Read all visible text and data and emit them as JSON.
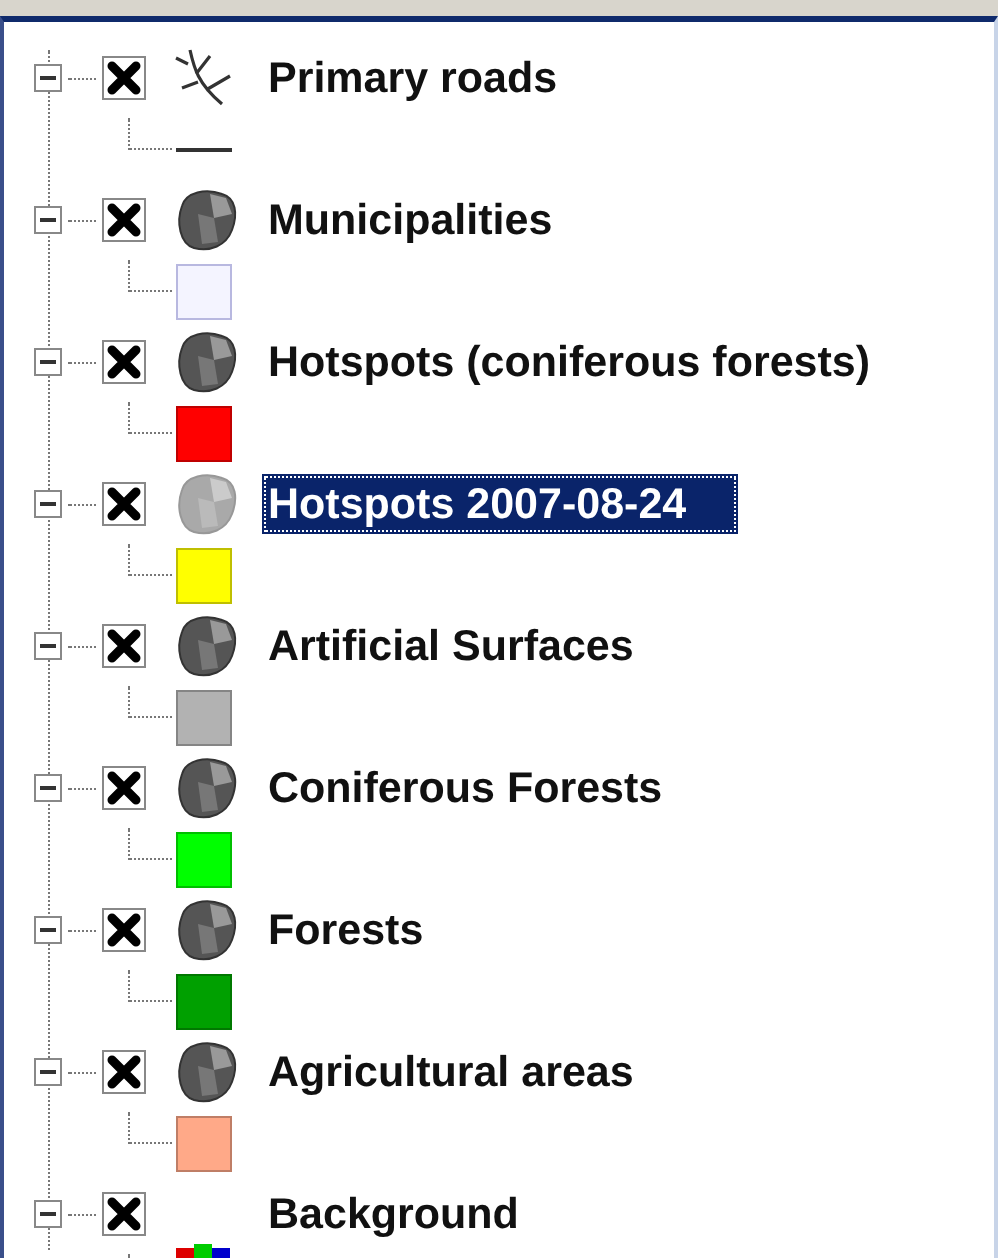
{
  "layers": [
    {
      "name": "Primary roads",
      "checked": true,
      "selected": false,
      "kind": "line",
      "legend": {
        "kind": "line"
      }
    },
    {
      "name": "Municipalities",
      "checked": true,
      "selected": false,
      "kind": "polygon",
      "legend": {
        "kind": "swatch",
        "color": "#f4f4ff"
      }
    },
    {
      "name": "Hotspots (coniferous forests)",
      "checked": true,
      "selected": false,
      "kind": "polygon",
      "legend": {
        "kind": "swatch",
        "color": "#ff0000"
      }
    },
    {
      "name": "Hotspots 2007-08-24",
      "checked": true,
      "selected": true,
      "kind": "polygon",
      "legend": {
        "kind": "swatch",
        "color": "#ffff00"
      }
    },
    {
      "name": "Artificial Surfaces",
      "checked": true,
      "selected": false,
      "kind": "polygon",
      "legend": {
        "kind": "swatch",
        "color": "#b2b2b2"
      }
    },
    {
      "name": "Coniferous Forests",
      "checked": true,
      "selected": false,
      "kind": "polygon",
      "legend": {
        "kind": "swatch",
        "color": "#00ff00"
      }
    },
    {
      "name": "Forests",
      "checked": true,
      "selected": false,
      "kind": "polygon",
      "legend": {
        "kind": "swatch",
        "color": "#00a000"
      }
    },
    {
      "name": "Agricultural areas",
      "checked": true,
      "selected": false,
      "kind": "polygon",
      "legend": {
        "kind": "swatch",
        "color": "#ffa988"
      }
    },
    {
      "name": "Background",
      "checked": true,
      "selected": false,
      "kind": "raster",
      "legend": {
        "kind": "raster"
      }
    }
  ]
}
